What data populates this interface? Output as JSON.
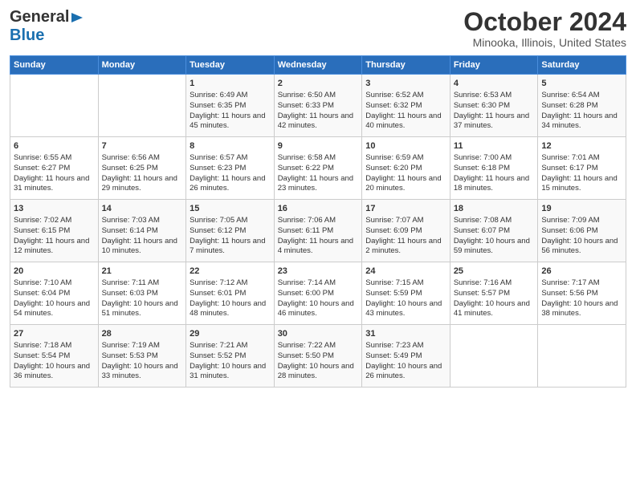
{
  "header": {
    "logo_line1": "General",
    "logo_line2": "Blue",
    "title": "October 2024",
    "subtitle": "Minooka, Illinois, United States"
  },
  "days_of_week": [
    "Sunday",
    "Monday",
    "Tuesday",
    "Wednesday",
    "Thursday",
    "Friday",
    "Saturday"
  ],
  "weeks": [
    [
      {
        "day": "",
        "content": ""
      },
      {
        "day": "",
        "content": ""
      },
      {
        "day": "1",
        "content": "Sunrise: 6:49 AM\nSunset: 6:35 PM\nDaylight: 11 hours and 45 minutes."
      },
      {
        "day": "2",
        "content": "Sunrise: 6:50 AM\nSunset: 6:33 PM\nDaylight: 11 hours and 42 minutes."
      },
      {
        "day": "3",
        "content": "Sunrise: 6:52 AM\nSunset: 6:32 PM\nDaylight: 11 hours and 40 minutes."
      },
      {
        "day": "4",
        "content": "Sunrise: 6:53 AM\nSunset: 6:30 PM\nDaylight: 11 hours and 37 minutes."
      },
      {
        "day": "5",
        "content": "Sunrise: 6:54 AM\nSunset: 6:28 PM\nDaylight: 11 hours and 34 minutes."
      }
    ],
    [
      {
        "day": "6",
        "content": "Sunrise: 6:55 AM\nSunset: 6:27 PM\nDaylight: 11 hours and 31 minutes."
      },
      {
        "day": "7",
        "content": "Sunrise: 6:56 AM\nSunset: 6:25 PM\nDaylight: 11 hours and 29 minutes."
      },
      {
        "day": "8",
        "content": "Sunrise: 6:57 AM\nSunset: 6:23 PM\nDaylight: 11 hours and 26 minutes."
      },
      {
        "day": "9",
        "content": "Sunrise: 6:58 AM\nSunset: 6:22 PM\nDaylight: 11 hours and 23 minutes."
      },
      {
        "day": "10",
        "content": "Sunrise: 6:59 AM\nSunset: 6:20 PM\nDaylight: 11 hours and 20 minutes."
      },
      {
        "day": "11",
        "content": "Sunrise: 7:00 AM\nSunset: 6:18 PM\nDaylight: 11 hours and 18 minutes."
      },
      {
        "day": "12",
        "content": "Sunrise: 7:01 AM\nSunset: 6:17 PM\nDaylight: 11 hours and 15 minutes."
      }
    ],
    [
      {
        "day": "13",
        "content": "Sunrise: 7:02 AM\nSunset: 6:15 PM\nDaylight: 11 hours and 12 minutes."
      },
      {
        "day": "14",
        "content": "Sunrise: 7:03 AM\nSunset: 6:14 PM\nDaylight: 11 hours and 10 minutes."
      },
      {
        "day": "15",
        "content": "Sunrise: 7:05 AM\nSunset: 6:12 PM\nDaylight: 11 hours and 7 minutes."
      },
      {
        "day": "16",
        "content": "Sunrise: 7:06 AM\nSunset: 6:11 PM\nDaylight: 11 hours and 4 minutes."
      },
      {
        "day": "17",
        "content": "Sunrise: 7:07 AM\nSunset: 6:09 PM\nDaylight: 11 hours and 2 minutes."
      },
      {
        "day": "18",
        "content": "Sunrise: 7:08 AM\nSunset: 6:07 PM\nDaylight: 10 hours and 59 minutes."
      },
      {
        "day": "19",
        "content": "Sunrise: 7:09 AM\nSunset: 6:06 PM\nDaylight: 10 hours and 56 minutes."
      }
    ],
    [
      {
        "day": "20",
        "content": "Sunrise: 7:10 AM\nSunset: 6:04 PM\nDaylight: 10 hours and 54 minutes."
      },
      {
        "day": "21",
        "content": "Sunrise: 7:11 AM\nSunset: 6:03 PM\nDaylight: 10 hours and 51 minutes."
      },
      {
        "day": "22",
        "content": "Sunrise: 7:12 AM\nSunset: 6:01 PM\nDaylight: 10 hours and 48 minutes."
      },
      {
        "day": "23",
        "content": "Sunrise: 7:14 AM\nSunset: 6:00 PM\nDaylight: 10 hours and 46 minutes."
      },
      {
        "day": "24",
        "content": "Sunrise: 7:15 AM\nSunset: 5:59 PM\nDaylight: 10 hours and 43 minutes."
      },
      {
        "day": "25",
        "content": "Sunrise: 7:16 AM\nSunset: 5:57 PM\nDaylight: 10 hours and 41 minutes."
      },
      {
        "day": "26",
        "content": "Sunrise: 7:17 AM\nSunset: 5:56 PM\nDaylight: 10 hours and 38 minutes."
      }
    ],
    [
      {
        "day": "27",
        "content": "Sunrise: 7:18 AM\nSunset: 5:54 PM\nDaylight: 10 hours and 36 minutes."
      },
      {
        "day": "28",
        "content": "Sunrise: 7:19 AM\nSunset: 5:53 PM\nDaylight: 10 hours and 33 minutes."
      },
      {
        "day": "29",
        "content": "Sunrise: 7:21 AM\nSunset: 5:52 PM\nDaylight: 10 hours and 31 minutes."
      },
      {
        "day": "30",
        "content": "Sunrise: 7:22 AM\nSunset: 5:50 PM\nDaylight: 10 hours and 28 minutes."
      },
      {
        "day": "31",
        "content": "Sunrise: 7:23 AM\nSunset: 5:49 PM\nDaylight: 10 hours and 26 minutes."
      },
      {
        "day": "",
        "content": ""
      },
      {
        "day": "",
        "content": ""
      }
    ]
  ]
}
